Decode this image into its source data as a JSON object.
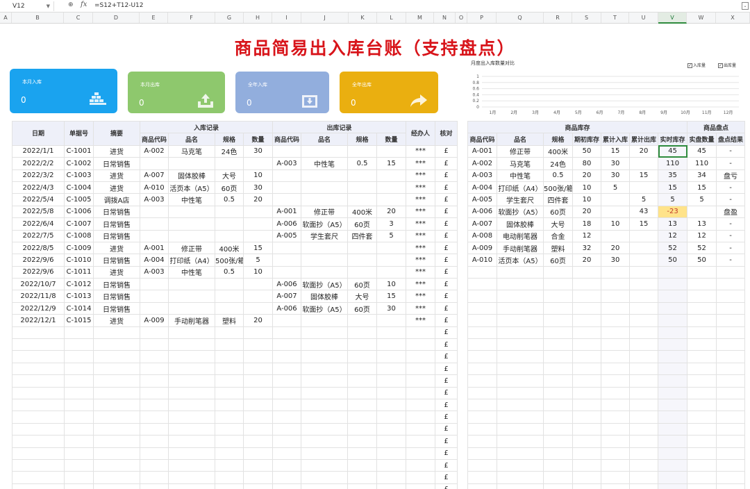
{
  "formula_bar": {
    "cell_ref": "V12",
    "fx_label": "fx",
    "formula": "=S12+T12-U12"
  },
  "columns": [
    "A",
    "B",
    "C",
    "D",
    "E",
    "F",
    "G",
    "H",
    "I",
    "J",
    "K",
    "L",
    "M",
    "N",
    "O",
    "P",
    "Q",
    "R",
    "S",
    "T",
    "U",
    "V",
    "W",
    "X"
  ],
  "selected_column": "V",
  "title": "商品简易出入库台账（支持盘点）",
  "cards": [
    {
      "label": "本月入库",
      "value": "0",
      "color": "#1aa3ef",
      "icon": "stacked-boxes-icon"
    },
    {
      "label": "本月出库",
      "value": "0",
      "color": "#8ec86d",
      "icon": "upload-tray-icon"
    },
    {
      "label": "全年入库",
      "value": "0",
      "color": "#92aedd",
      "icon": "inbox-download-icon"
    },
    {
      "label": "全年出库",
      "value": "0",
      "color": "#eaaf10",
      "icon": "share-arrow-icon"
    }
  ],
  "chart_data": {
    "type": "bar",
    "title": "月度出入库数量对比",
    "categories": [
      "1月",
      "2月",
      "3月",
      "4月",
      "5月",
      "6月",
      "7月",
      "8月",
      "9月",
      "10月",
      "11月",
      "12月"
    ],
    "series": [
      {
        "name": "入库量",
        "values": [
          0,
          0,
          0,
          0,
          0,
          0,
          0,
          0,
          0,
          0,
          0,
          0
        ]
      },
      {
        "name": "出库量",
        "values": [
          0,
          0,
          0,
          0,
          0,
          0,
          0,
          0,
          0,
          0,
          0,
          0
        ]
      }
    ],
    "yticks": [
      "1",
      "0.8",
      "0.6",
      "0.4",
      "0.2",
      "0"
    ],
    "ylim": [
      0,
      1
    ],
    "legend": "top-right",
    "checkbox_mark": "✓"
  },
  "ledger": {
    "headers_top": {
      "date": "日期",
      "doc": "单据号",
      "summary": "摘要",
      "in": "入库记录",
      "out": "出库记录",
      "agent": "经办人",
      "check": "核对"
    },
    "headers_sub": [
      "商品代码",
      "品名",
      "规格",
      "数量",
      "商品代码",
      "品名",
      "规格",
      "数量"
    ],
    "rows": [
      [
        "2022/1/1",
        "C-1001",
        "进货",
        "A-002",
        "马克笔",
        "24色",
        "30",
        "",
        "",
        "",
        "",
        "***",
        "£"
      ],
      [
        "2022/2/2",
        "C-1002",
        "日常销售",
        "",
        "",
        "",
        "",
        "A-003",
        "中性笔",
        "0.5",
        "15",
        "***",
        "£"
      ],
      [
        "2022/3/2",
        "C-1003",
        "进货",
        "A-007",
        "固体胶棒",
        "大号",
        "10",
        "",
        "",
        "",
        "",
        "***",
        "£"
      ],
      [
        "2022/4/3",
        "C-1004",
        "进货",
        "A-010",
        "活页本（A5）",
        "60页",
        "30",
        "",
        "",
        "",
        "",
        "***",
        "£"
      ],
      [
        "2022/5/4",
        "C-1005",
        "调拨A店",
        "A-003",
        "中性笔",
        "0.5",
        "20",
        "",
        "",
        "",
        "",
        "***",
        "£"
      ],
      [
        "2022/5/8",
        "C-1006",
        "日常销售",
        "",
        "",
        "",
        "",
        "A-001",
        "修正带",
        "400米",
        "20",
        "***",
        "£"
      ],
      [
        "2022/6/4",
        "C-1007",
        "日常销售",
        "",
        "",
        "",
        "",
        "A-006",
        "软面抄（A5）",
        "60页",
        "3",
        "***",
        "£"
      ],
      [
        "2022/7/5",
        "C-1008",
        "日常销售",
        "",
        "",
        "",
        "",
        "A-005",
        "学生套尺",
        "四件套",
        "5",
        "***",
        "£"
      ],
      [
        "2022/8/5",
        "C-1009",
        "进货",
        "A-001",
        "修正带",
        "400米",
        "15",
        "",
        "",
        "",
        "",
        "***",
        "£"
      ],
      [
        "2022/9/6",
        "C-1010",
        "日常销售",
        "A-004",
        "打印纸（A4）",
        "500张/箱",
        "5",
        "",
        "",
        "",
        "",
        "***",
        "£"
      ],
      [
        "2022/9/6",
        "C-1011",
        "进货",
        "A-003",
        "中性笔",
        "0.5",
        "10",
        "",
        "",
        "",
        "",
        "***",
        "£"
      ],
      [
        "2022/10/7",
        "C-1012",
        "日常销售",
        "",
        "",
        "",
        "",
        "A-006",
        "软面抄（A5）",
        "60页",
        "10",
        "***",
        "£"
      ],
      [
        "2022/11/8",
        "C-1013",
        "日常销售",
        "",
        "",
        "",
        "",
        "A-007",
        "固体胶棒",
        "大号",
        "15",
        "***",
        "£"
      ],
      [
        "2022/12/9",
        "C-1014",
        "日常销售",
        "",
        "",
        "",
        "",
        "A-006",
        "软面抄（A5）",
        "60页",
        "30",
        "***",
        "£"
      ],
      [
        "2022/12/1",
        "C-1015",
        "进货",
        "A-009",
        "手动削笔器",
        "塑料",
        "20",
        "",
        "",
        "",
        "",
        "***",
        "£"
      ]
    ],
    "empty_check_mark": "£"
  },
  "inventory": {
    "header_stock": "商品库存",
    "header_count": "商品盘点",
    "columns": [
      "商品代码",
      "品名",
      "规格",
      "期初库存",
      "累计入库",
      "累计出库",
      "实时库存",
      "实盘数量",
      "盘点结果"
    ],
    "rows": [
      [
        "A-001",
        "修正带",
        "400米",
        "50",
        "15",
        "20",
        "45",
        "45",
        "-"
      ],
      [
        "A-002",
        "马克笔",
        "24色",
        "80",
        "30",
        "",
        "110",
        "110",
        "-"
      ],
      [
        "A-003",
        "中性笔",
        "0.5",
        "20",
        "30",
        "15",
        "35",
        "34",
        "盘亏"
      ],
      [
        "A-004",
        "打印纸（A4）",
        "500张/箱",
        "10",
        "5",
        "",
        "15",
        "15",
        "-"
      ],
      [
        "A-005",
        "学生套尺",
        "四件套",
        "10",
        "",
        "5",
        "5",
        "5",
        "-"
      ],
      [
        "A-006",
        "软面抄（A5）",
        "60页",
        "20",
        "",
        "43",
        "-23",
        "",
        "盘盈"
      ],
      [
        "A-007",
        "固体胶棒",
        "大号",
        "18",
        "10",
        "15",
        "13",
        "13",
        "-"
      ],
      [
        "A-008",
        "电动削笔器",
        "合金",
        "12",
        "",
        "",
        "12",
        "12",
        "-"
      ],
      [
        "A-009",
        "手动削笔器",
        "塑料",
        "32",
        "20",
        "",
        "52",
        "52",
        "-"
      ],
      [
        "A-010",
        "活页本（A5）",
        "60页",
        "20",
        "30",
        "",
        "50",
        "50",
        "-"
      ]
    ]
  }
}
